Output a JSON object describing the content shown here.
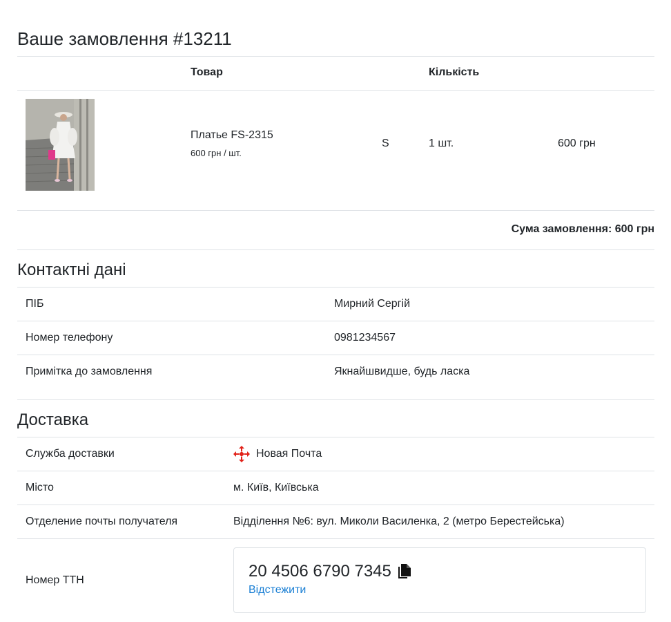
{
  "order": {
    "title": "Ваше замовлення #13211",
    "columns": {
      "product": "Товар",
      "quantity": "Кількість"
    },
    "item": {
      "name": "Платье FS-2315",
      "unit_price": "600 грн / шт.",
      "size": "S",
      "quantity": "1 шт.",
      "price": "600 грн"
    },
    "total": "Сума замовлення: 600 грн"
  },
  "contacts": {
    "title": "Контактні дані",
    "rows": [
      {
        "label": "ПІБ",
        "value": "Мирний Сергій"
      },
      {
        "label": "Номер телефону",
        "value": "0981234567"
      },
      {
        "label": "Примітка до замовлення",
        "value": "Якнайшвидше, будь ласка"
      }
    ]
  },
  "delivery": {
    "title": "Доставка",
    "rows": [
      {
        "label": "Служба доставки",
        "value": "Новая Почта"
      },
      {
        "label": "Місто",
        "value": "м. Київ, Київська"
      },
      {
        "label": "Отделение почты получателя",
        "value": "Відділення №6: вул. Миколи Василенка, 2 (метро Берестейська)"
      }
    ],
    "ttn": {
      "label": "Номер ТТН",
      "number": "20 4506 6790 7345",
      "track_label": "Відстежити"
    },
    "service_icon": "nova-poshta-logo-icon",
    "brand_color": "#e2231a"
  },
  "colors": {
    "link": "#1a7fd4",
    "border": "#dee2e6"
  }
}
